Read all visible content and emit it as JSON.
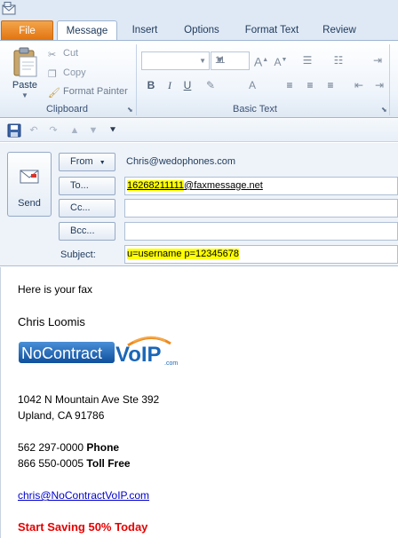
{
  "ribbon": {
    "tabs": {
      "file": "File",
      "message": "Message",
      "insert": "Insert",
      "options": "Options",
      "format_text": "Format Text",
      "review": "Review"
    },
    "clipboard": {
      "paste": "Paste",
      "cut": "Cut",
      "copy": "Copy",
      "format_painter": "Format Painter",
      "group_label": "Clipboard"
    },
    "basic_text": {
      "font_size": "11",
      "group_label": "Basic Text"
    }
  },
  "header": {
    "send_label": "Send",
    "from_button": "From",
    "from_value": "Chris@wedophones.com",
    "to_button": "To...",
    "to_number": "16268211111",
    "to_domain": "@faxmessage.net",
    "cc_button": "Cc...",
    "bcc_button": "Bcc...",
    "subject_label": "Subject:",
    "subject_value": "u=username p=12345678"
  },
  "body": {
    "greeting": "Here is your fax",
    "signature_name": "Chris Loomis",
    "logo_text_left": "NoContract",
    "logo_text_right": "VoIP",
    "logo_suffix": ".com",
    "address_line1": "1042 N Mountain Ave Ste 392",
    "address_line2": "Upland, CA 91786",
    "phone_number": "562 297-0000",
    "phone_label": "Phone",
    "tollfree_number": "866 550-0005",
    "tollfree_label": "Toll Free",
    "email": "chris@NoContractVoIP.com",
    "promo": "Start Saving 50% Today"
  },
  "colors": {
    "file_tab": "#e2730f",
    "highlight": "#ffff00",
    "promo": "#e60000",
    "link": "#0000cc",
    "logo_blue": "#1a66b8",
    "logo_orange": "#f08a1c"
  }
}
